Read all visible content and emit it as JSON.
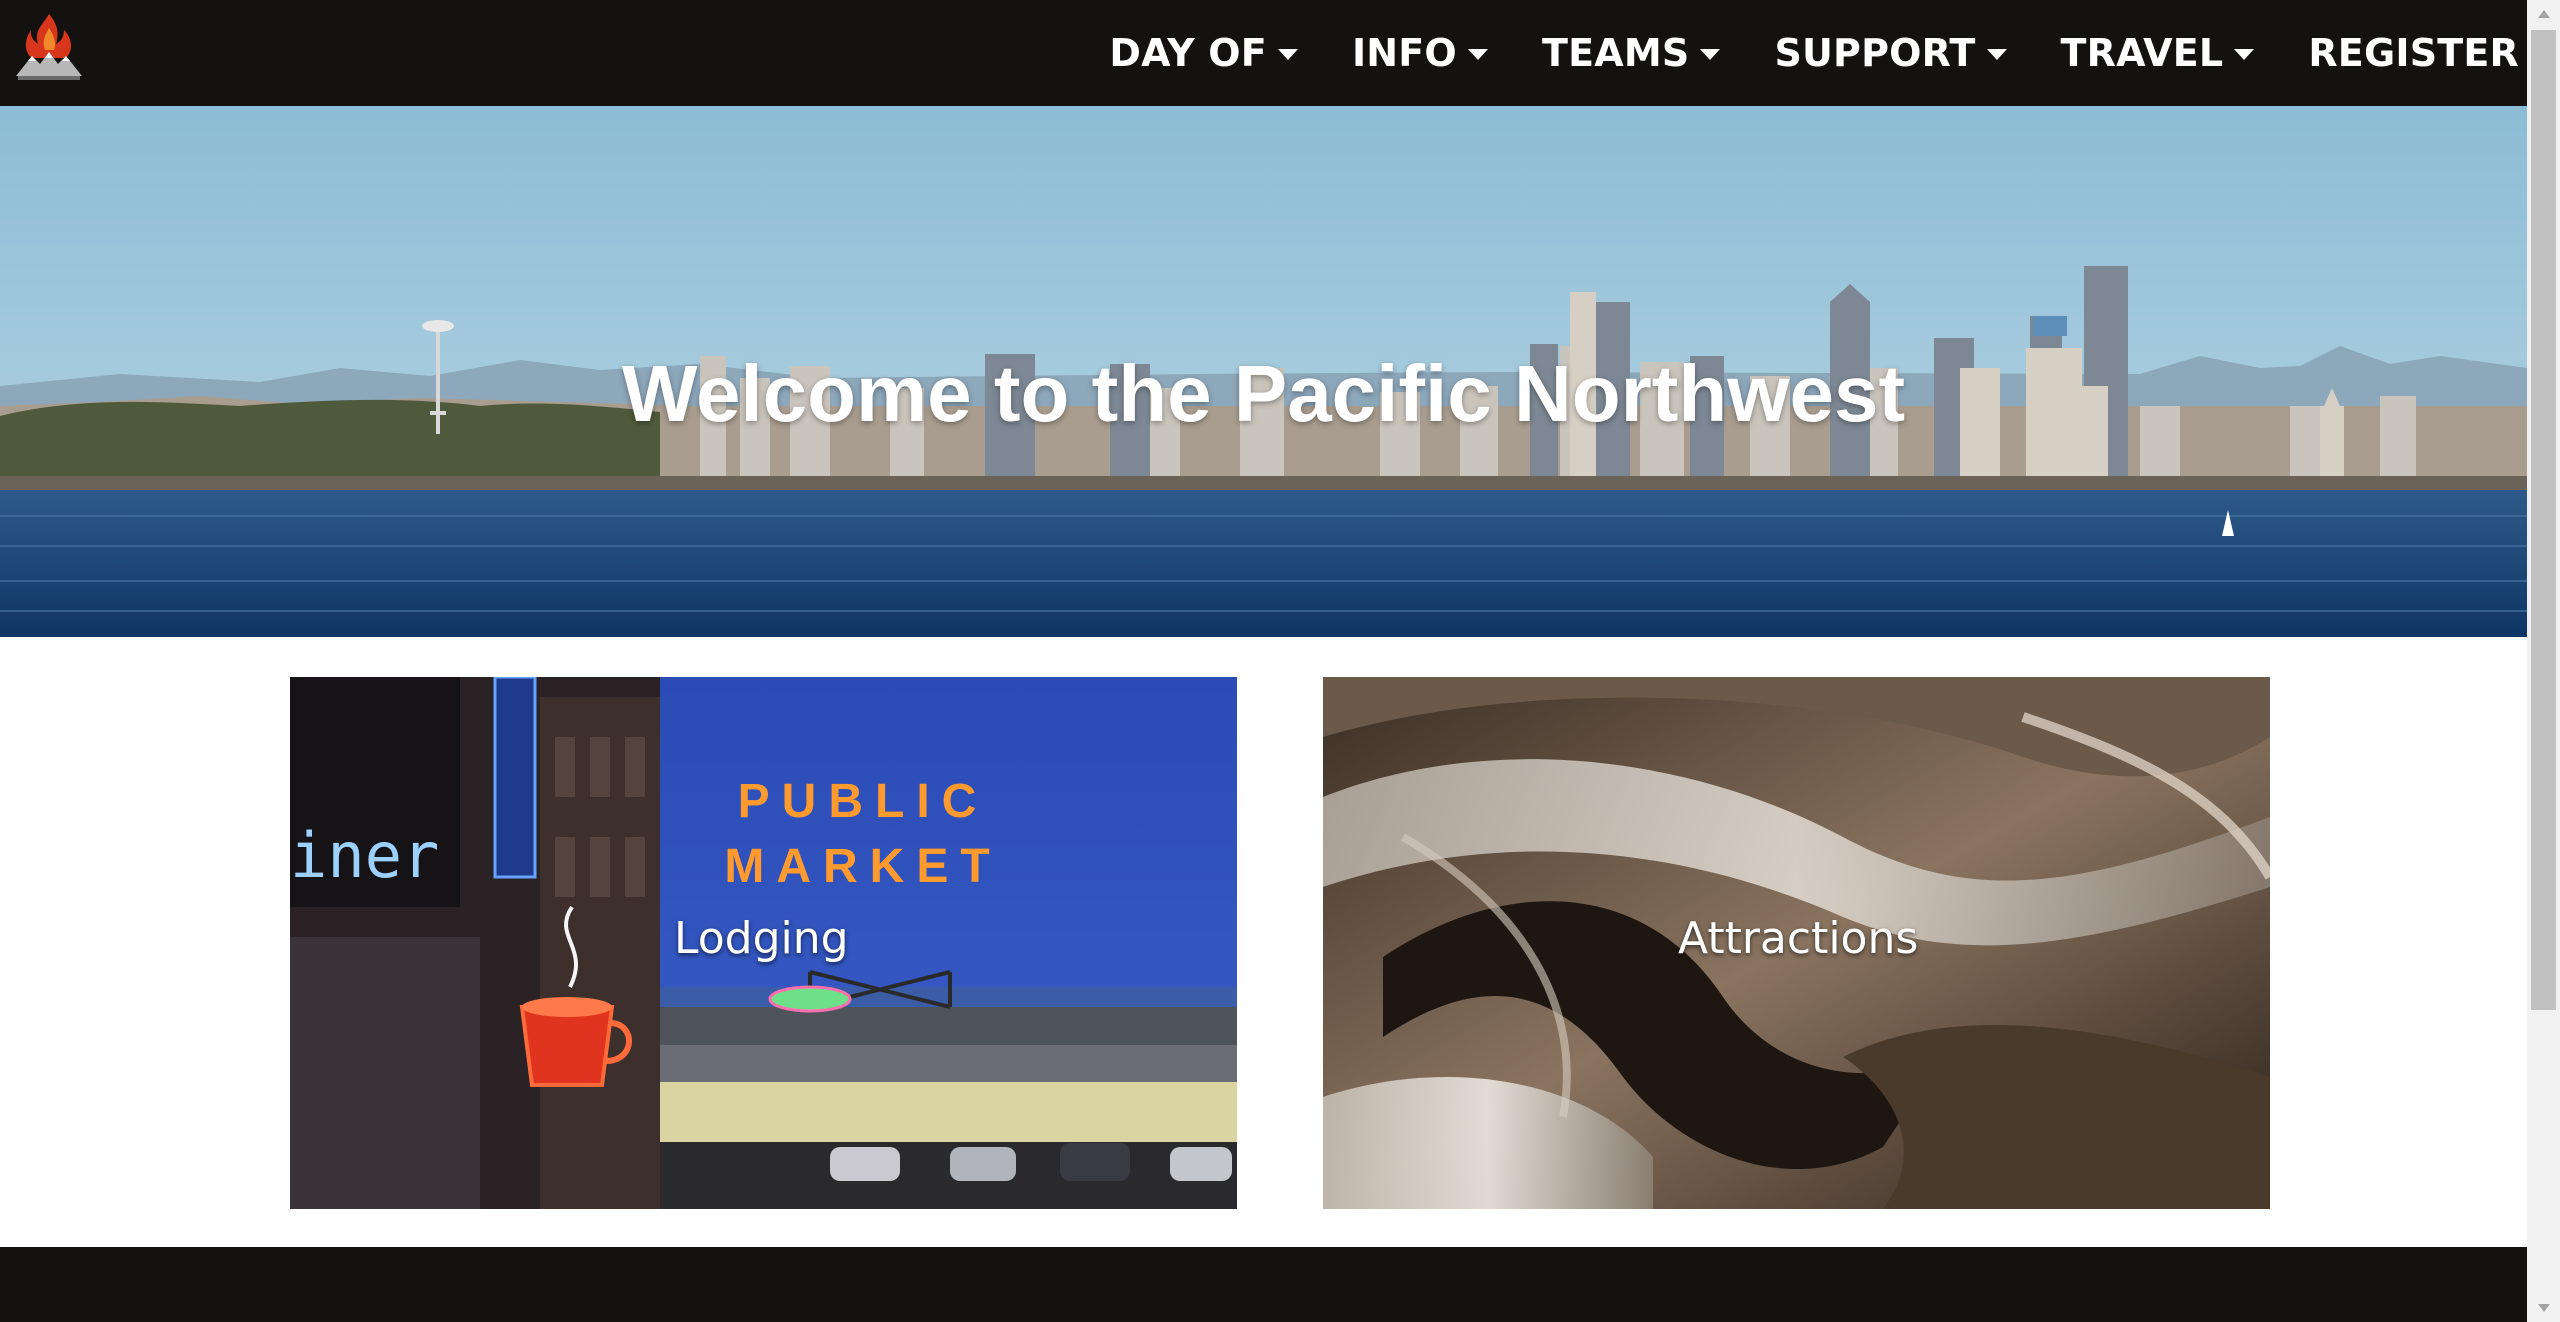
{
  "nav": {
    "items": [
      {
        "label": "DAY OF",
        "has_dropdown": true
      },
      {
        "label": "INFO",
        "has_dropdown": true
      },
      {
        "label": "TEAMS",
        "has_dropdown": true
      },
      {
        "label": "SUPPORT",
        "has_dropdown": true
      },
      {
        "label": "TRAVEL",
        "has_dropdown": true
      },
      {
        "label": "REGISTER",
        "has_dropdown": false
      }
    ],
    "logo_icon": "flame-mountain-logo-icon",
    "dropdown_icon": "caret-down-icon"
  },
  "hero": {
    "title": "Welcome to the Pacific Northwest",
    "image": "seattle-skyline-image"
  },
  "cards": [
    {
      "label": "Lodging",
      "image": "public-market-image"
    },
    {
      "label": "Attractions",
      "image": "curved-metal-architecture-image"
    }
  ],
  "colors": {
    "navbar_bg": "#141211",
    "footer_bg": "#141211",
    "text": "#ffffff"
  }
}
